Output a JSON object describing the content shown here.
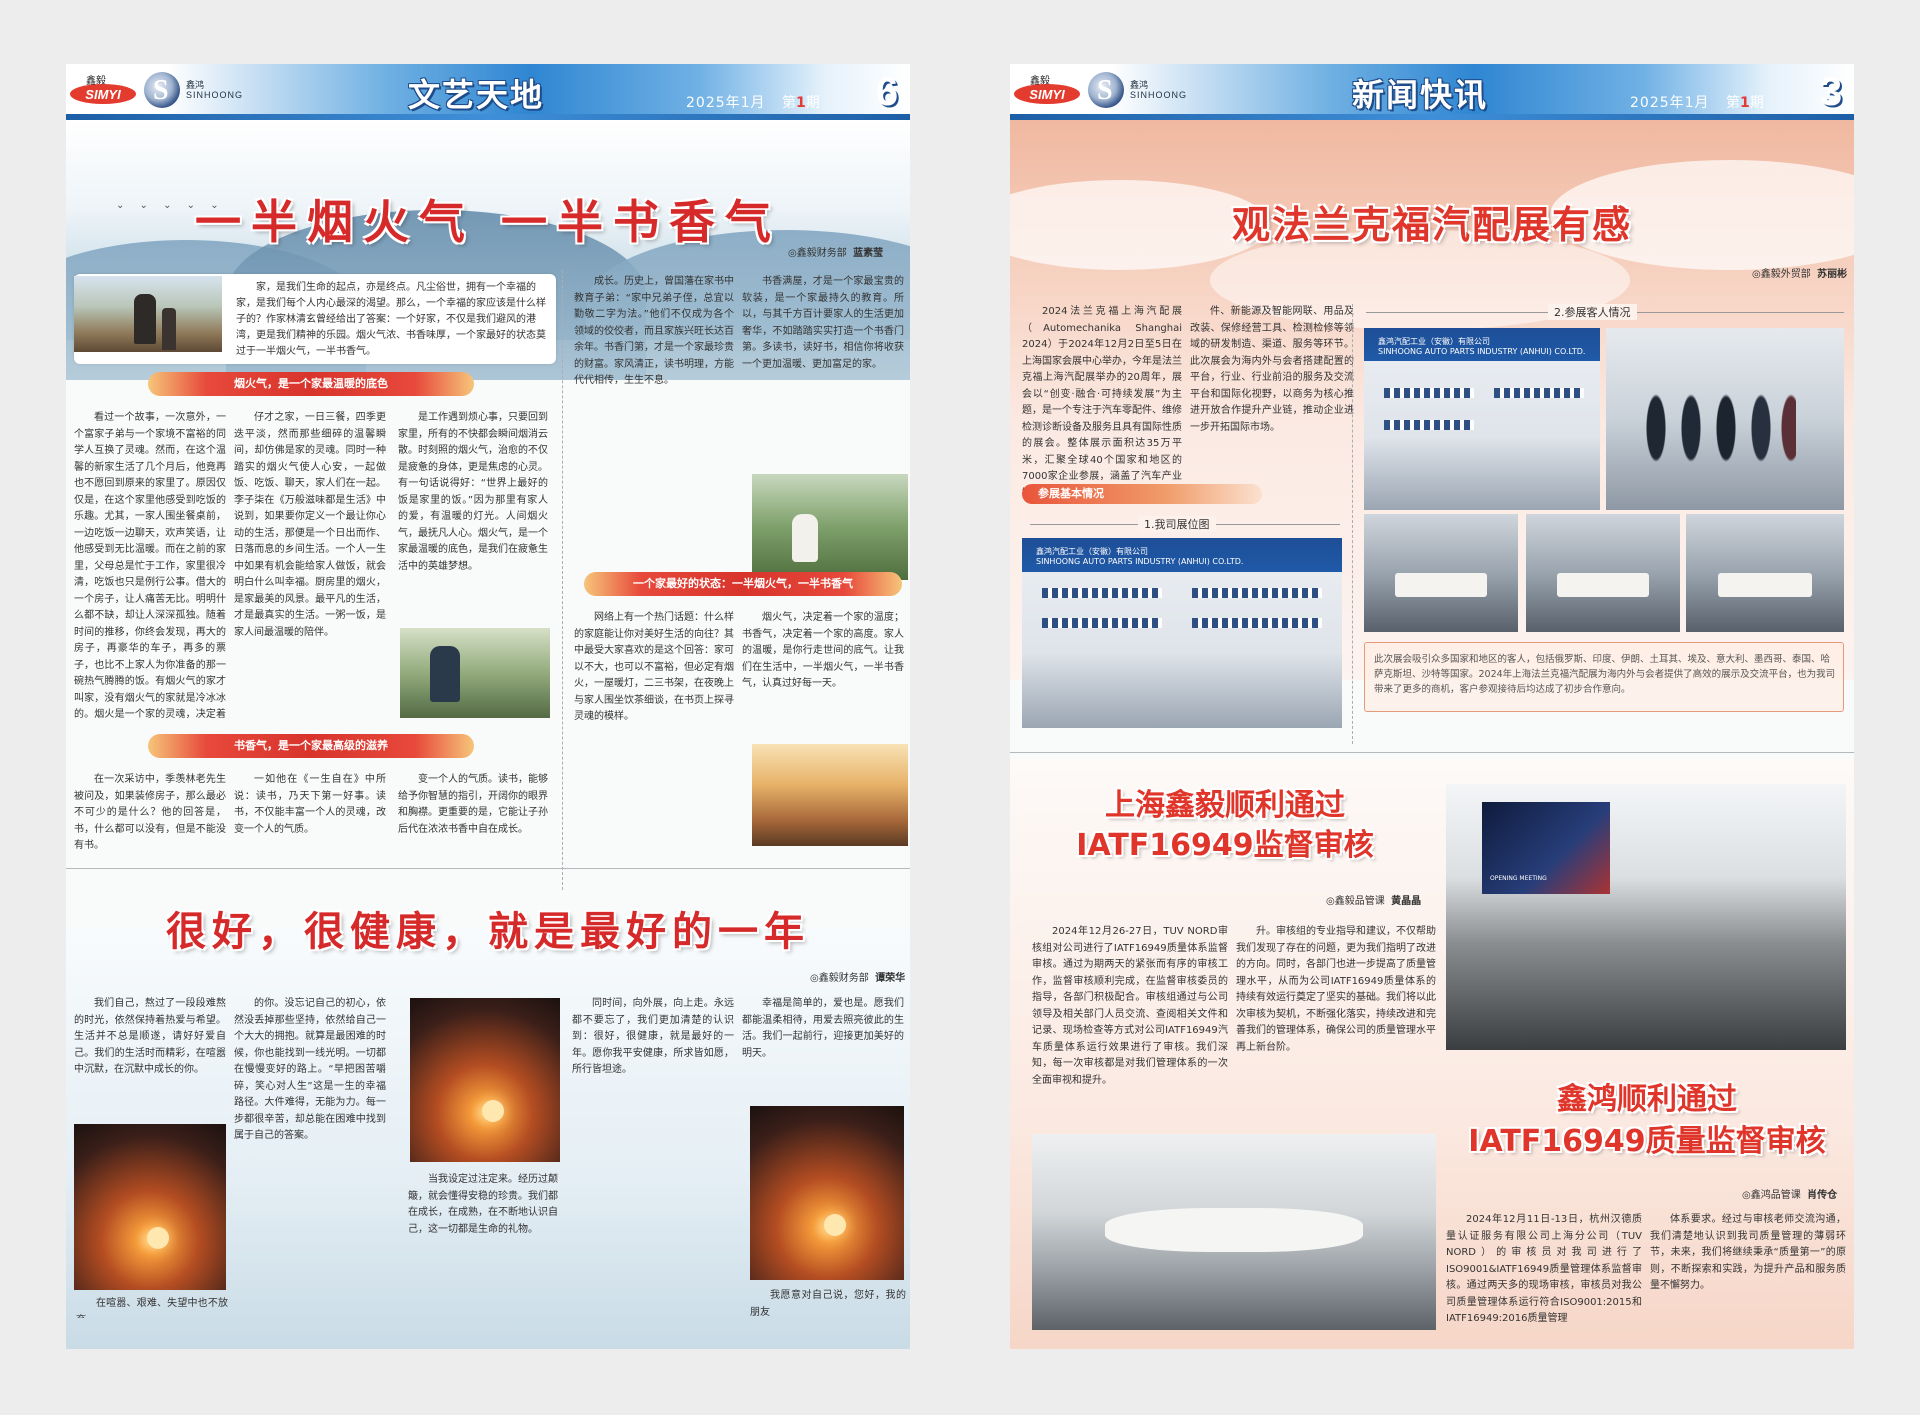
{
  "left_page": {
    "header": {
      "logo_simyi_cn": "鑫毅",
      "logo_simyi": "SIMYI",
      "logo_sh_cn": "鑫鸿",
      "logo_sh": "SINHOONG",
      "section_title": "文艺天地",
      "date": "2025年1月",
      "issue_prefix": "第",
      "issue_number": "1",
      "issue_suffix": "期",
      "page_number": "6"
    },
    "article1": {
      "title": "一半烟火气 一半书香气",
      "dept": "鑫毅财务部",
      "author": "蓝素莹",
      "intro": "家，是我们生命的起点，亦是终点。凡尘俗世，拥有一个幸福的家，是我们每个人内心最深的渴望。那么，一个幸福的家应该是什么样子的？作家林清玄曾经给出了答案：一个好家，不仅是我们避风的港湾，更是我们精神的乐园。烟火气浓、书香味厚，一个家最好的状态莫过于一半烟火气，一半书香气。",
      "section1_heading": "烟火气，是一个家最温暖的底色",
      "col1_text": "看过一个故事，一次意外，一个富家子弟与一个家境不富裕的同学人互换了灵魂。然而，在这个温馨的新家生活了几个月后，他竟再也不愿回到原来的家里了。原因仅仅是，在这个家里他感受到吃饭的乐趣。尤其，一家人围坐餐桌前，一边吃饭一边聊天，欢声笑语，让他感受到无比温暖。而在之前的家里，父母总是忙于工作，家里很冷清，吃饭也只是例行公事。借大的一个房子，让人痛苦无比。明明什么都不缺，却让人深深孤独。随着时间的推移，你终会发现，再大的房子，再豪华的车子，再多的票子，也比不上家人为你准备的那一碗热气腾腾的饭。有烟火气的家才叫家，没有烟火气的家就是冷冰冰的。烟火是一个家的灵魂，决定着一个家的温度。",
      "col2_text": "仔才之家，一日三餐，四季更迭平淡，然而那些细碎的温馨瞬间，却仿佛是家的灵魂。同时一种踏实的烟火气使人心安，一起做饭、吃饭、聊天，家人们在一起。李子柒在《万般滋味都是生活》中说到，如果要你定义一个最让你心动的生活，那便是一个日出而作、日落而息的乡间生活。一个人一生中如果有机会能给家人做饭，就会明白什么叫幸福。厨房里的烟火，是家最美的风景。最平凡的生活，才是最真实的生活。一粥一饭，是家人间最温暖的陪伴。",
      "col3_text": "是工作遇到烦心事，只要回到家里，所有的不快都会瞬间烟消云散。时刻照的烟火气，治愈的不仅是疲惫的身体，更是焦虑的心灵。有一句话说得好：“世界上最好的饭是家里的饭。”因为那里有家人的爱，有温暖的灯光。人间烟火气，最抚凡人心。烟火气，是一个家最温暖的底色，是我们在疲惫生活中的英雄梦想。",
      "section2_heading": "书香气，是一个家最高级的滋养",
      "col1b_text": "在一次采访中，季羡林老先生被问及，如果装修房子，那么最必不可少的是什么？他的回答是，书，什么都可以没有，但是不能没有书。",
      "col2b_text": "一如他在《一生自在》中所说：读书，乃天下第一好事。读书，不仅能丰富一个人的灵魂，改变一个人的气质。",
      "col3b_text": "变一个人的气质。读书，能够给予你智慧的指引，开阔你的眼界和胸襟。更重要的是，它能让子孙后代在浓浓书香中自在成长。",
      "col4_text": "成长。历史上，曾国藩在家书中教育子弟：“家中兄弟子侄，总宜以勤敬二字为法。”他们不仅成为各个领域的佼佼者，而且家族兴旺长达百余年。书香门第，才是一个家最珍贵的财富。家风清正，读书明理，方能代代相传，生生不息。",
      "section3_heading": "一个家最好的状态：一半烟火气，一半书香气",
      "col4b_text": "网络上有一个热门话题：什么样的家庭能让你对美好生活的向往？其中最受大家喜欢的是这个回答：家可以不大，也可以不富裕，但必定有烟火，一屋暖灯，二三书架，在夜晚上与家人围坐饮茶细谈，在书页上探寻灵魂的模样。",
      "col5_text": "书香满屋，才是一个家最宝贵的软装，是一个家最持久的教育。所以，与其千方百计要家人的生活更加奢华，不如踏踏实实打造一个书香门第。多读书，读好书，相信你将收获一个更加温暖、更加富足的家。",
      "col5b_text": "烟火气，决定着一个家的温度；书香气，决定着一个家的高度。家人的温暖，是你行走世间的底气。让我们在生活中，一半烟火气，一半书香气，认真过好每一天。"
    },
    "article2": {
      "title": "很好，很健康，就是最好的一年",
      "dept": "鑫毅财务部",
      "author": "谭荣华",
      "col1_text": "我们自己，熬过了一段段难熬的时光，依然保持着热爱与希望。生活并不总是顺遂，请好好爱自己。我们的生活时而精彩，在喧嚣中沉默，在沉默中成长的你。",
      "col1_caption": "在喧嚣、艰难、失望中也不放弃",
      "col2_text": "的你。没忘记自己的初心，依然没丢掉那些坚持，依然给自己一个大大的拥抱。就算是最困难的时候，你也能找到一线光明。一切都在慢慢变好的路上。“早把困苦嚼碎，笑心对人生”这是一生的幸福路径。大件难得，无能为力。每一步都很辛苦，却总能在困难中找到属于自己的答案。",
      "col3_text": "当我设定过注定来。经历过颠簸，就会懂得安稳的珍贵。我们都在成长，在成熟，在不断地认识自己，这一切都是生命的礼物。",
      "col4_text": "同时间，向外展，向上走。永远都不要忘了，我们更加清楚的认识到：很好，很健康，就是最好的一年。愿你我平安健康，所求皆如愿，所行皆坦途。",
      "col5_text": "幸福是简单的，爱也是。愿我们都能温柔相待，用爱去照亮彼此的生活。我们一起前行，迎接更加美好的明天。",
      "col5_caption": "我愿意对自己说，您好，我的朋友"
    }
  },
  "right_page": {
    "header": {
      "logo_simyi_cn": "鑫毅",
      "logo_simyi": "SIMYI",
      "logo_sh_cn": "鑫鸿",
      "logo_sh": "SINHOONG",
      "section_title": "新闻快讯",
      "date": "2025年1月",
      "issue_prefix": "第",
      "issue_number": "1",
      "issue_suffix": "期",
      "page_number": "3"
    },
    "article1": {
      "title": "观法兰克福汽配展有感",
      "dept": "鑫毅外贸部",
      "author": "苏丽彬",
      "section1_label": "参展基本情况",
      "section1_sub": "1.我司展位图",
      "section2_sub": "2.参展客人情况",
      "intro_text": "2024法兰克福上海汽配展（Automechanika Shanghai 2024）于2024年12月2日至5日在上海国家会展中心举办，今年是法兰克福上海汽配展举办的20周年，展会以“创变·融合·可持续发展”为主题，是一个专注于汽车零配件、维修检测诊断设备及服务且具有国际性质的展会。整体展示面积达35万平米，汇聚全球40个国家和地区的7000家企业参展，涵盖了汽车产业链的各个环节，包括零部件",
      "col2_text": "件、新能源及智能网联、用品及改装、保修经营工具、检测检修等领域的研发制造、渠道、服务等环节。此次展会为海内外与会者搭建配置的平台，行业、行业前沿的服务及交流平台和国际化视野，以商务为核心推进开放合作提升产业链，推动企业进一步开拓国际市场。",
      "booth_name": "鑫鸿汽配工业（安徽）有限公司",
      "booth_name_en": "SINHOONG AUTO PARTS INDUSTRY (ANHUI) CO.LTD.",
      "summary": "此次展会吸引众多国家和地区的客人，包括俄罗斯、印度、伊朗、土耳其、埃及、意大利、墨西哥、泰国、哈萨克斯坦、沙特等国家。2024年上海法兰克福汽配展为海内外与会者提供了高效的展示及交流平台，也为我司带来了更多的商机，客户参观接待后均达成了初步合作意向。"
    },
    "article2": {
      "title_line1": "上海鑫毅顺利通过",
      "title_line2": "IATF16949监督审核",
      "dept": "鑫毅品管课",
      "author": "黄晶晶",
      "col1_text": "2024年12月26-27日，TUV NORD审核组对公司进行了IATF16949质量体系监督审核。通过为期两天的紧张而有序的审核工作，监督审核顺利完成，在监督审核委员的指导，各部门积极配合。审核组通过与公司领导及相关部门人员交流、查阅相关文件和记录、现场检查等方式对公司IATF16949汽车质量体系运行效果进行了审核。我们深知，每一次审核都是对我们管理体系的一次全面审视和提升。",
      "col2_text": "升。审核组的专业指导和建议，不仅帮助我们发现了存在的问题，更为我们指明了改进的方向。同时，各部门也进一步提高了质量管理水平，从而为公司IATF16949质量体系的持续有效运行奠定了坚实的基础。我们将以此次审核为契机，不断强化落实，持续改进和完善我们的管理体系，确保公司的质量管理水平再上新台阶。",
      "screen_text": "OPENING MEETING"
    },
    "article3": {
      "title_line1": "鑫鸿顺利通过",
      "title_line2": "IATF16949质量监督审核",
      "dept": "鑫鸿品管课",
      "author": "肖传仓",
      "col1_text": "2024年12月11日-13日，杭州汉德质量认证服务有限公司上海分公司（TUV NORD）的审核员对我司进行了ISO9001&IATF16949质量管理体系监督审核。通过两天多的现场审核，审核员对我公司质量管理体系运行符合ISO9001:2015和IATF16949:2016质量管理",
      "col2_text": "体系要求。经过与审核老师交流沟通，我们清楚地认识到我司质量管理的薄弱环节，未来，我们将继续秉承“质量第一”的原则，不断探索和实践，为提升产品和服务质量不懈努力。"
    }
  }
}
